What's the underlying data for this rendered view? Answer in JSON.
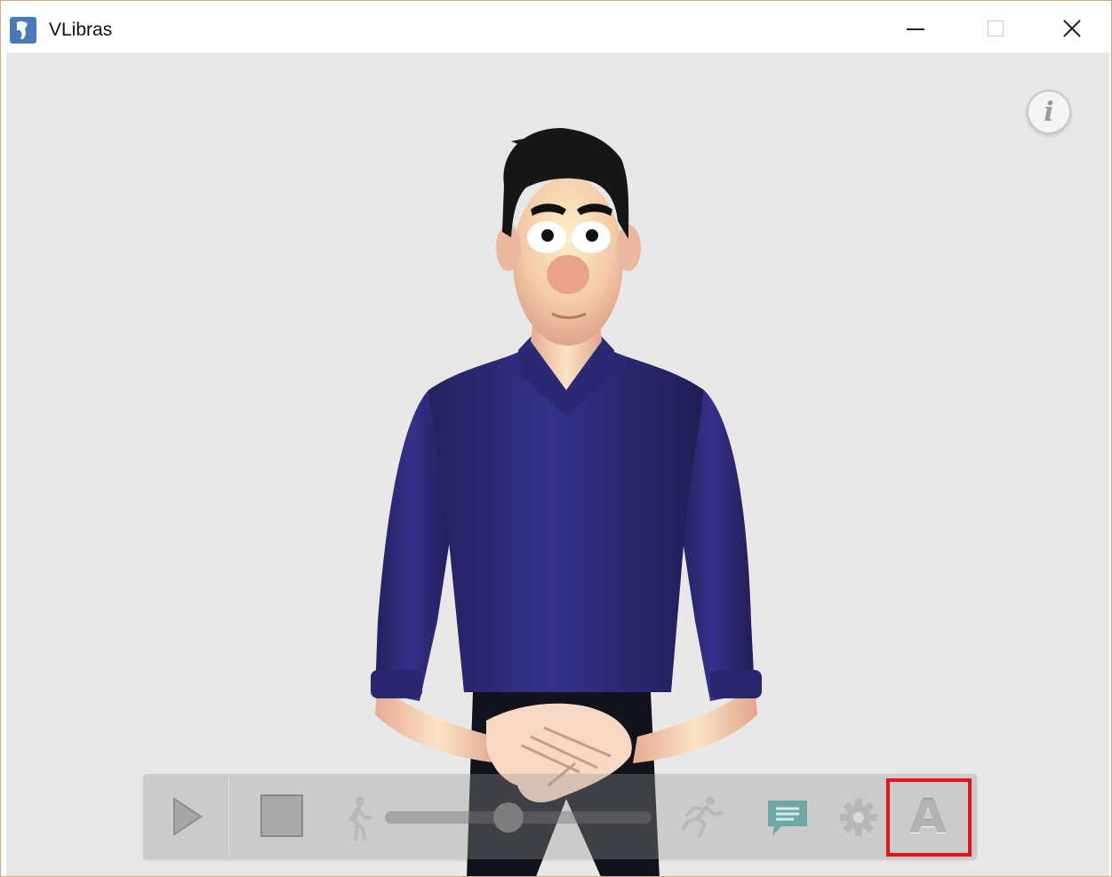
{
  "window": {
    "title": "VLibras",
    "controls": {
      "minimize": "minimize-icon",
      "maximize": "maximize-icon",
      "close": "close-icon",
      "close_glyph": "✕"
    }
  },
  "stage": {
    "background": "#e8e8e8",
    "info_button": {
      "glyph": "i",
      "icon": "info-icon"
    },
    "avatar": {
      "icon": "sign-language-avatar",
      "shirt_color": "#2d2a73",
      "skin_color": "#f2c4a8",
      "hair_color": "#1b1b1b",
      "pants_color": "#141420"
    }
  },
  "toolbar": {
    "play": {
      "icon": "play-icon"
    },
    "stop": {
      "icon": "stop-icon"
    },
    "speed_slow": {
      "icon": "walking-person-icon"
    },
    "speed_slider": {
      "value": 0.45
    },
    "speed_fast": {
      "icon": "running-person-icon"
    },
    "subtitles": {
      "icon": "speech-bubble-icon",
      "color": "#6fa6a6"
    },
    "settings": {
      "icon": "gear-icon"
    },
    "language": {
      "glyph": "A",
      "icon": "letter-a-icon",
      "highlight_color": "#e8111c"
    }
  }
}
